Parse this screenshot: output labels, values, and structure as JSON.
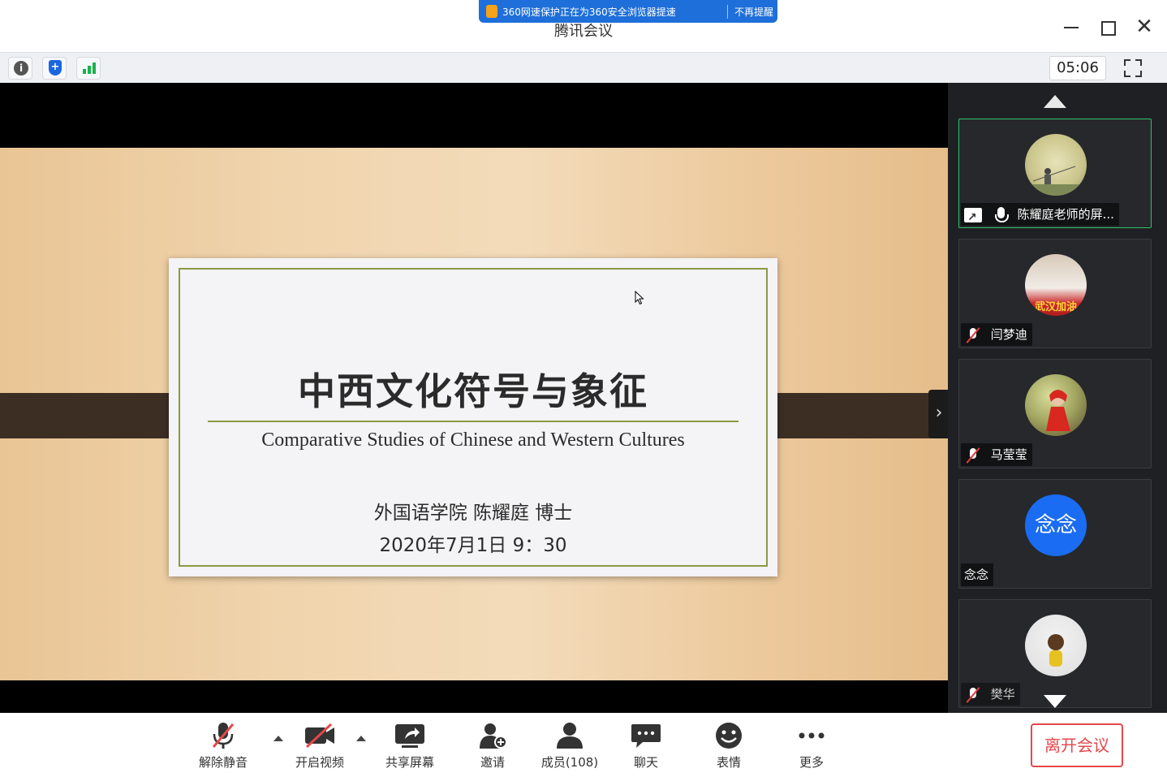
{
  "window": {
    "title": "腾讯会议",
    "close_glyph": "✕"
  },
  "banner": {
    "text": "360网速保护正在为360安全浏览器提速",
    "dismiss": "不再提醒"
  },
  "toolbar": {
    "info_glyph": "i",
    "shield_glyph": "+",
    "timer": "05:06"
  },
  "slide": {
    "title": "中西文化符号与象征",
    "subtitle": "Comparative Studies of Chinese and Western Cultures",
    "author": "外国语学院 陈耀庭 博士",
    "date": "2020年7月1日 9：30"
  },
  "panel": {
    "expand_glyph": "›",
    "participants": [
      {
        "name": "陈耀庭老师的屏...",
        "mic": "on",
        "sharing": true,
        "active": true
      },
      {
        "name": "闫梦迪",
        "mic": "muted",
        "avatar_text": "武汉加油"
      },
      {
        "name": "马莹莹",
        "mic": "muted"
      },
      {
        "name": "念念",
        "mic": "none",
        "avatar_text": "念念"
      },
      {
        "name": "樊华",
        "mic": "muted"
      }
    ]
  },
  "controls": {
    "unmute": "解除静音",
    "start_video": "开启视频",
    "share_screen": "共享屏幕",
    "invite": "邀请",
    "members": "成员(108)",
    "chat": "聊天",
    "reactions": "表情",
    "more": "更多",
    "leave": "离开会议"
  },
  "colors": {
    "accent_blue": "#1a6cf2",
    "leave_red": "#e4484b",
    "active_green": "#2fc16a"
  }
}
